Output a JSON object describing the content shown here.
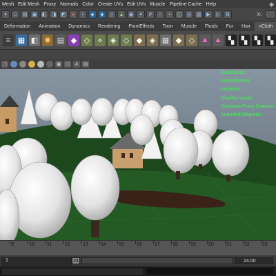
{
  "menubar": {
    "items": [
      "Mesh",
      "Edit Mesh",
      "Proxy",
      "Normals",
      "Color",
      "Create UVs",
      "Edit UVs",
      "Muscle",
      "Pipeline Cache",
      "Help"
    ],
    "logo": "◈"
  },
  "statusline": {
    "x_label": "X:"
  },
  "shelf": {
    "tabs": [
      "Deformation",
      "Animation",
      "Dynamics",
      "Rendering",
      "PaintEffects",
      "Toon",
      "Muscle",
      "Fluids",
      "Fur",
      "Hair",
      "nCloth"
    ]
  },
  "hud": {
    "lines": [
      "Backfaces:",
      "Smoothness:",
      "Instance:",
      "Display Layer:",
      "Distance From Camera:",
      "Selected Objects:"
    ]
  },
  "timeline": {
    "ticks": [
      "9",
      "10",
      "11",
      "12",
      "13",
      "14",
      "15",
      "16",
      "17",
      "18",
      "19",
      "20",
      "21",
      "22",
      "23"
    ]
  },
  "range": {
    "start": "1",
    "slider_value": "24",
    "end_value": "24.00"
  },
  "colors": {
    "hud_text": "#48e05a",
    "grass": "#1e4a1e",
    "sky": "#7e8b98"
  }
}
